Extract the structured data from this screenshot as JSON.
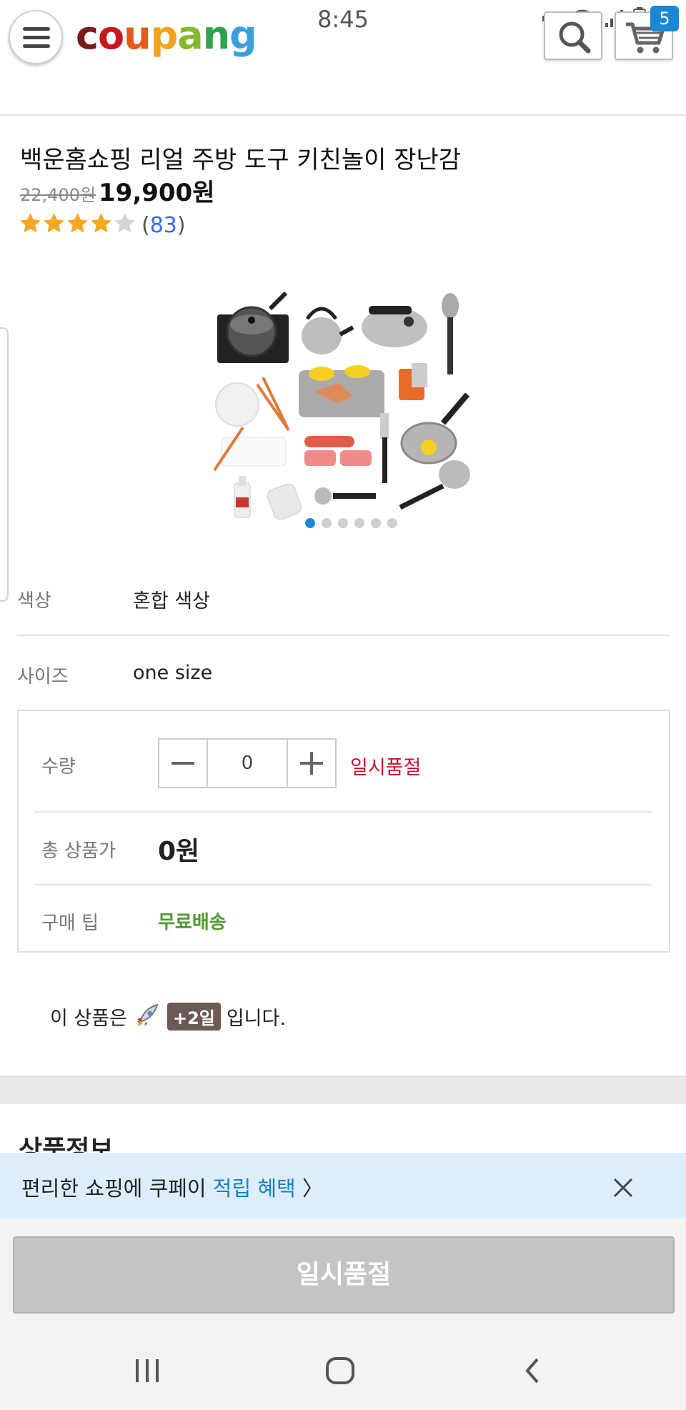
{
  "status_bar": {
    "time": "8:45"
  },
  "header": {
    "logo": {
      "c": "c",
      "o": "o",
      "u": "u",
      "p": "p",
      "a": "a",
      "n": "n",
      "g": "g"
    },
    "cart_count": "5"
  },
  "product": {
    "title": "백운홈쇼핑 리얼 주방 도구 키친놀이 장난감",
    "original_price": "22,400원",
    "sale_price": "19,900원",
    "rating": 4,
    "rating_max": 5,
    "review_count": "83",
    "image_count": 6,
    "active_image": 1
  },
  "options": {
    "color_label": "색상",
    "color_value": "혼합 색상",
    "size_label": "사이즈",
    "size_value": "one size"
  },
  "order": {
    "qty_label": "수량",
    "qty_value": "0",
    "status": "일시품절",
    "total_label": "총 상품가",
    "total_value": "0원",
    "tip_label": "구매 팁",
    "tip_value": "무료배송"
  },
  "delivery": {
    "prefix": "이 상품은",
    "badge": "+2일",
    "suffix": "입니다."
  },
  "section_title": "상품정보",
  "promo": {
    "text": "편리한 쇼핑에 쿠페이 ",
    "highlight": "적립 혜택",
    "chevron": "〉"
  },
  "soldout_button": "일시품절",
  "colors": {
    "logo_c": "#7a1b1b",
    "logo_o": "#c9161c",
    "logo_u": "#e45a1a",
    "logo_p": "#f1a31b",
    "logo_a": "#86b82c",
    "logo_n": "#2fa24a",
    "logo_g": "#3ba0d8",
    "accent": "#1a88d6",
    "soldout": "#c8102e",
    "free_shipping": "#4f9a2c",
    "star": "#f5a623"
  }
}
